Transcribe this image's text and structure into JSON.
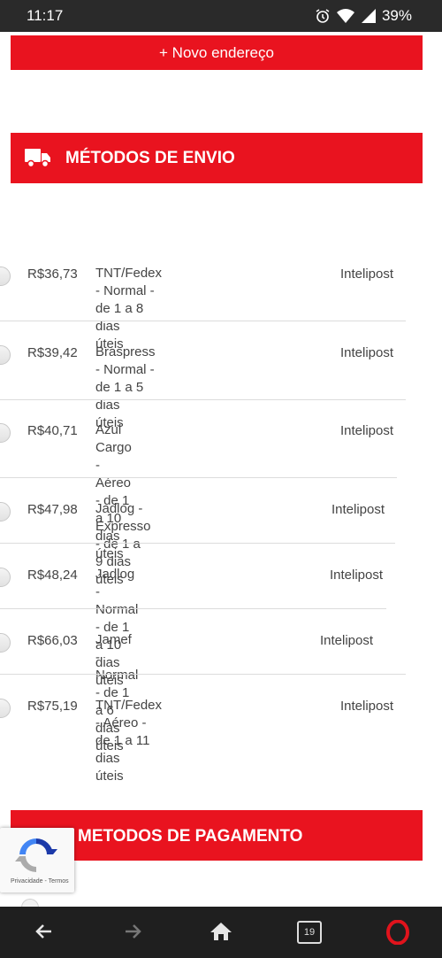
{
  "status_bar": {
    "time": "11:17",
    "battery": "39%"
  },
  "new_address_label": "+ Novo endereço",
  "shipping": {
    "title": "MÉTODOS DE ENVIO",
    "options": [
      {
        "price": "R$36,73",
        "desc_line1": "TNT/Fedex - Normal - de 1 a 8 dias",
        "desc_line2": "úteis",
        "carrier": "Intelipost"
      },
      {
        "price": "R$39,42",
        "desc_line1": "Braspress - Normal - de 1 a 5 dias",
        "desc_line2": "úteis",
        "carrier": "Intelipost"
      },
      {
        "price": "R$40,71",
        "desc_line1": "Azul Cargo - Aéreo - de 1 a 10 dias",
        "desc_line2": "úteis",
        "carrier": "Intelipost"
      },
      {
        "price": "R$47,98",
        "desc_line1": "Jadlog - Expresso - de 1 a 9 dias úteis",
        "desc_line2": "",
        "carrier": "Intelipost"
      },
      {
        "price": "R$48,24",
        "desc_line1": "Jadlog - Normal - de 1 a 10 dias úteis",
        "desc_line2": "",
        "carrier": "Intelipost"
      },
      {
        "price": "R$66,03",
        "desc_line1": "Jamef - Normal - de 1 a 6 dias úteis",
        "desc_line2": "",
        "carrier": "Intelipost"
      },
      {
        "price": "R$75,19",
        "desc_line1": "TNT/Fedex - Aéreo - de 1 a 11 dias",
        "desc_line2": "úteis",
        "carrier": "Intelipost"
      }
    ]
  },
  "payment": {
    "title": "METODOS DE PAGAMENTO"
  },
  "recaptcha": {
    "links": "Privacidade - Termos"
  },
  "browser_nav": {
    "tab_count": "19"
  },
  "colors": {
    "accent": "#e9131f",
    "navbar": "#1f1f1f",
    "statusbar": "#2a2a2a"
  }
}
